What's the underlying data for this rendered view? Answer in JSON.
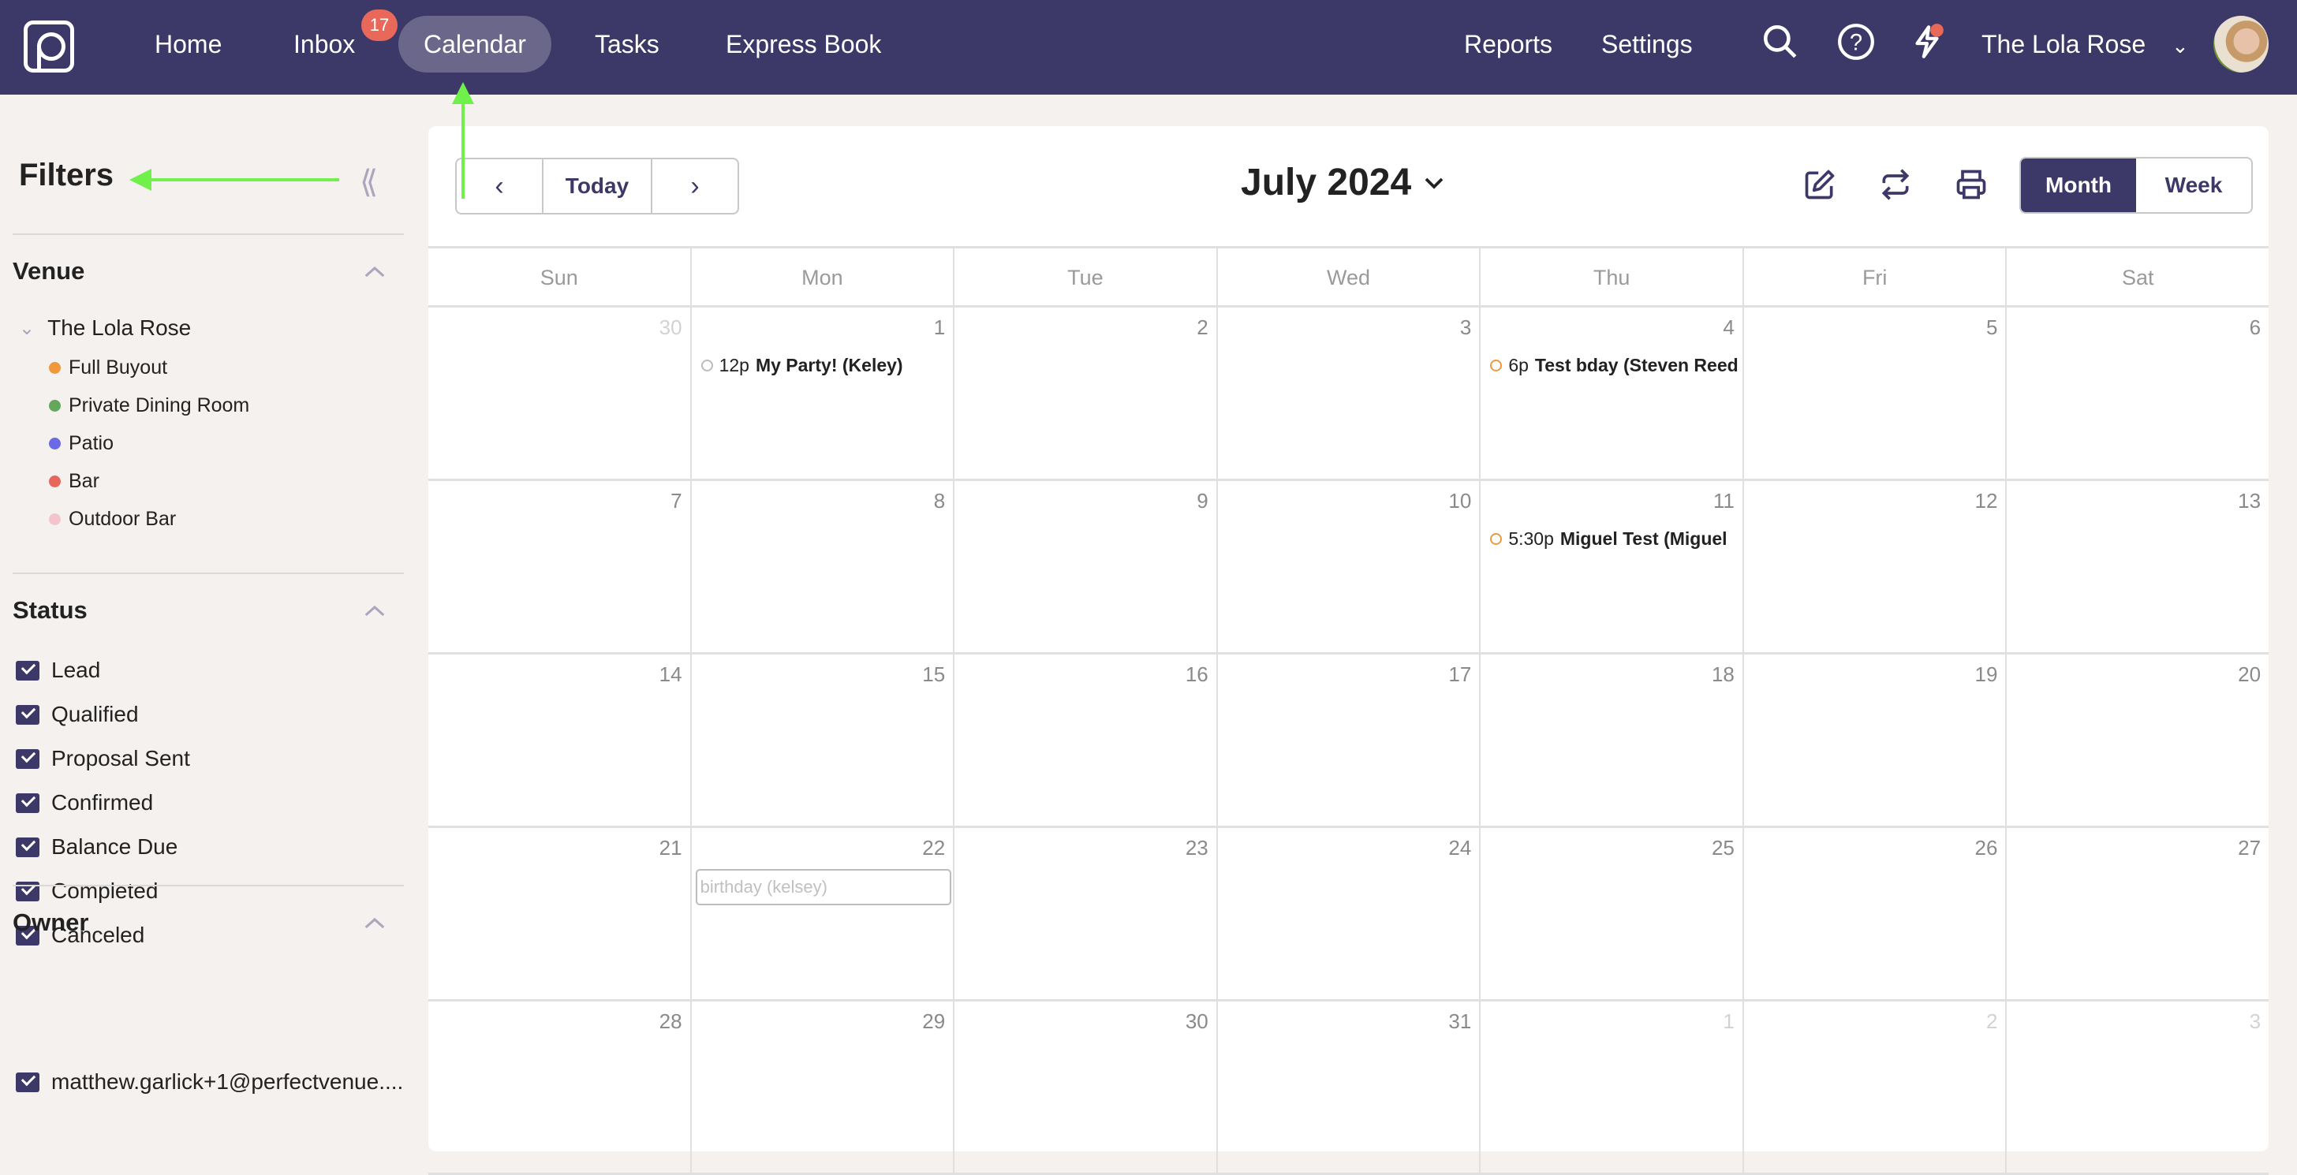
{
  "topnav": {
    "items": [
      {
        "label": "Home"
      },
      {
        "label": "Inbox",
        "badge": "17"
      },
      {
        "label": "Calendar",
        "active": true
      },
      {
        "label": "Tasks"
      },
      {
        "label": "Express Book"
      }
    ],
    "right_items": [
      {
        "label": "Reports"
      },
      {
        "label": "Settings"
      }
    ],
    "icons": [
      "search-icon",
      "help-icon",
      "lightning-icon"
    ],
    "venue": "The Lola Rose"
  },
  "sidebar": {
    "title": "Filters",
    "venue": {
      "title": "Venue",
      "root": "The Lola Rose",
      "spaces": [
        {
          "label": "Full Buyout",
          "color": "#f0993a"
        },
        {
          "label": "Private Dining Room",
          "color": "#63a85a"
        },
        {
          "label": "Patio",
          "color": "#6a6ae8"
        },
        {
          "label": "Bar",
          "color": "#e8665a"
        },
        {
          "label": "Outdoor Bar",
          "color": "#f4c4cc"
        }
      ]
    },
    "status": {
      "title": "Status",
      "items": [
        {
          "label": "Lead",
          "checked": true
        },
        {
          "label": "Qualified",
          "checked": true
        },
        {
          "label": "Proposal Sent",
          "checked": true
        },
        {
          "label": "Confirmed",
          "checked": true
        },
        {
          "label": "Balance Due",
          "checked": true
        },
        {
          "label": "Completed",
          "checked": true
        },
        {
          "label": "Canceled",
          "checked": true
        }
      ]
    },
    "owner": {
      "title": "Owner",
      "items": [
        {
          "label": "matthew.garlick+1@perfectvenue....",
          "checked": true
        }
      ]
    }
  },
  "calendar": {
    "today_label": "Today",
    "month_title": "July 2024",
    "views": [
      {
        "label": "Month",
        "active": true
      },
      {
        "label": "Week",
        "active": false
      }
    ],
    "weekdays": [
      "Sun",
      "Mon",
      "Tue",
      "Wed",
      "Thu",
      "Fri",
      "Sat"
    ],
    "weeks": [
      [
        {
          "d": "30",
          "other": true
        },
        {
          "d": "1"
        },
        {
          "d": "2"
        },
        {
          "d": "3"
        },
        {
          "d": "4"
        },
        {
          "d": "5"
        },
        {
          "d": "6"
        }
      ],
      [
        {
          "d": "7"
        },
        {
          "d": "8"
        },
        {
          "d": "9"
        },
        {
          "d": "10"
        },
        {
          "d": "11"
        },
        {
          "d": "12"
        },
        {
          "d": "13"
        }
      ],
      [
        {
          "d": "14"
        },
        {
          "d": "15"
        },
        {
          "d": "16"
        },
        {
          "d": "17"
        },
        {
          "d": "18"
        },
        {
          "d": "19"
        },
        {
          "d": "20"
        }
      ],
      [
        {
          "d": "21"
        },
        {
          "d": "22"
        },
        {
          "d": "23"
        },
        {
          "d": "24"
        },
        {
          "d": "25"
        },
        {
          "d": "26"
        },
        {
          "d": "27"
        }
      ],
      [
        {
          "d": "28"
        },
        {
          "d": "29"
        },
        {
          "d": "30"
        },
        {
          "d": "31"
        },
        {
          "d": "1",
          "other": true
        },
        {
          "d": "2",
          "other": true
        },
        {
          "d": "3",
          "other": true
        }
      ]
    ],
    "events": [
      {
        "week": 0,
        "day": 1,
        "time": "12p",
        "title": "My Party! (Keley)",
        "ring_color": "#bbbbbb"
      },
      {
        "week": 0,
        "day": 4,
        "time": "6p",
        "title": "Test bday (Steven Reed",
        "ring_color": "#f0993a"
      },
      {
        "week": 1,
        "day": 4,
        "time": "5:30p",
        "title": "Miguel Test (Miguel",
        "ring_color": "#f0993a"
      }
    ],
    "new_event": {
      "week": 3,
      "day": 1,
      "placeholder": "birthday (kelsey)"
    }
  }
}
